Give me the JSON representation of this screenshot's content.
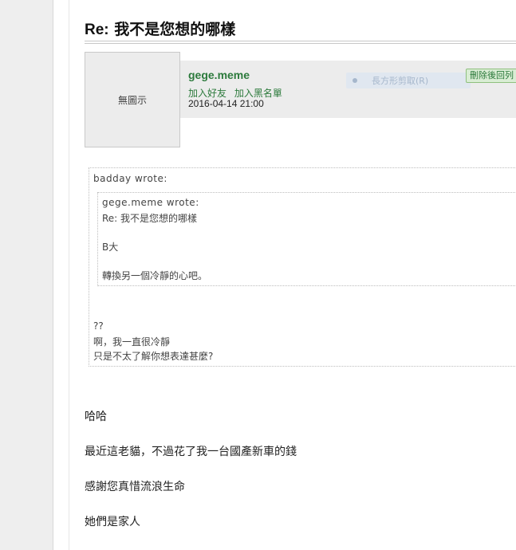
{
  "post": {
    "title_prefix": "Re:",
    "title_text": "我不是您想的哪樣"
  },
  "author": {
    "avatar_text": "無圖示",
    "username": "gege.meme",
    "add_friend": "加入好友",
    "add_blacklist": "加入黑名單",
    "date": "2016-04-14 21:00"
  },
  "toolbar": {
    "snip_label": "長方形剪取(R)",
    "delete_label": "刪除後回列"
  },
  "quote": {
    "outer_author": "badday wrote:",
    "inner_author": "gege.meme wrote:",
    "inner_lines": [
      "Re: 我不是您想的哪樣",
      "B大",
      "轉換另一個冷靜的心吧。"
    ],
    "outer_lines": [
      "??",
      "啊，我一直很冷靜",
      "只是不太了解你想表達甚麼?"
    ]
  },
  "body": {
    "lines": [
      "哈哈",
      "最近這老貓，不過花了我一台國產新車的錢",
      "感謝您真惜流浪生命",
      "她們是家人"
    ]
  }
}
